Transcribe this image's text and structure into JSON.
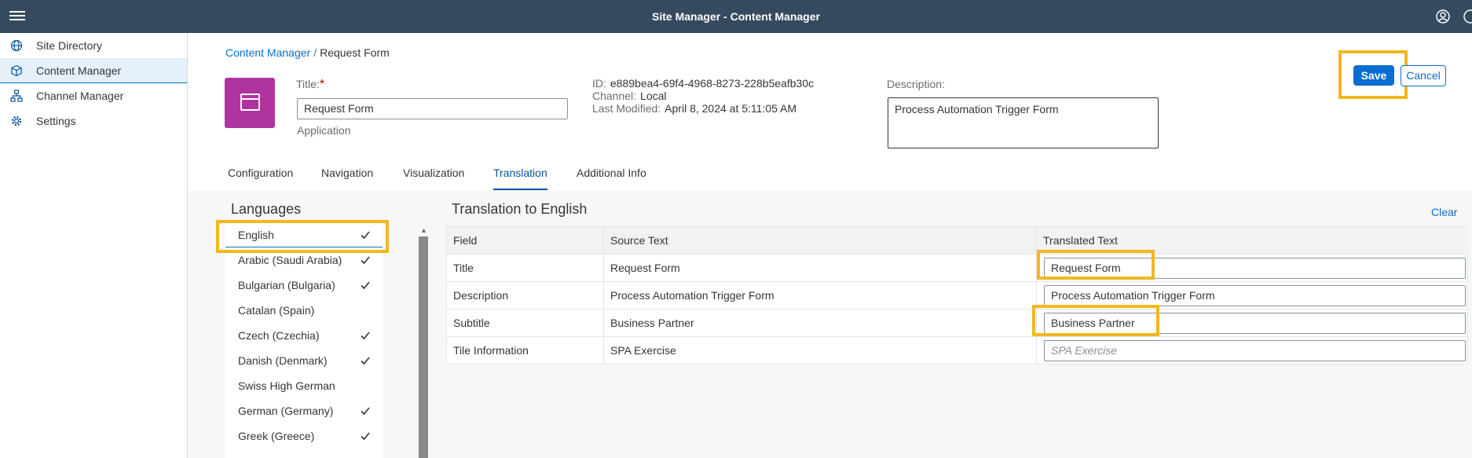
{
  "shell": {
    "title": "Site Manager - Content Manager"
  },
  "sidenav": {
    "items": [
      {
        "label": "Site Directory",
        "icon": "globe-icon"
      },
      {
        "label": "Content Manager",
        "icon": "cube-icon",
        "active": true
      },
      {
        "label": "Channel Manager",
        "icon": "hierarchy-icon"
      },
      {
        "label": "Settings",
        "icon": "gear-icon"
      }
    ]
  },
  "breadcrumb": {
    "parent": "Content Manager",
    "separator": "/",
    "current": "Request Form"
  },
  "header": {
    "title_label": "Title:",
    "required_mark": "*",
    "title_value": "Request Form",
    "app_type": "Application",
    "id_label": "ID:",
    "id_value": "e889bea4-69f4-4968-8273-228b5eafb30c",
    "channel_label": "Channel:",
    "channel_value": "Local",
    "modified_label": "Last Modified:",
    "modified_value": "April 8, 2024 at 5:11:05 AM",
    "description_label": "Description:",
    "description_value": "Process Automation Trigger Form",
    "save_label": "Save",
    "cancel_label": "Cancel"
  },
  "tabs": [
    "Configuration",
    "Navigation",
    "Visualization",
    "Translation",
    "Additional Info"
  ],
  "active_tab": "Translation",
  "languages": {
    "heading": "Languages",
    "items": [
      {
        "name": "English",
        "checked": true
      },
      {
        "name": "Arabic (Saudi Arabia)",
        "checked": true
      },
      {
        "name": "Bulgarian (Bulgaria)",
        "checked": true
      },
      {
        "name": "Catalan (Spain)",
        "checked": false
      },
      {
        "name": "Czech (Czechia)",
        "checked": true
      },
      {
        "name": "Danish (Denmark)",
        "checked": true
      },
      {
        "name": "Swiss High German",
        "checked": false
      },
      {
        "name": "German (Germany)",
        "checked": true
      },
      {
        "name": "Greek (Greece)",
        "checked": true
      }
    ]
  },
  "translation": {
    "heading": "Translation to English",
    "clear_label": "Clear",
    "columns": [
      "Field",
      "Source Text",
      "Translated Text"
    ],
    "rows": [
      {
        "field": "Title",
        "source": "Request Form",
        "translated": "Request Form",
        "placeholder": ""
      },
      {
        "field": "Description",
        "source": "Process Automation Trigger Form",
        "translated": "Process Automation Trigger Form",
        "placeholder": ""
      },
      {
        "field": "Subtitle",
        "source": "Business Partner",
        "translated": "Business Partner",
        "placeholder": ""
      },
      {
        "field": "Tile Information",
        "source": "SPA Exercise",
        "translated": "",
        "placeholder": "SPA Exercise"
      }
    ]
  },
  "colors": {
    "shell": "#354a5f",
    "accent": "#0a6ed1",
    "highlight": "#f1b81f",
    "app_icon": "#b0349d"
  }
}
